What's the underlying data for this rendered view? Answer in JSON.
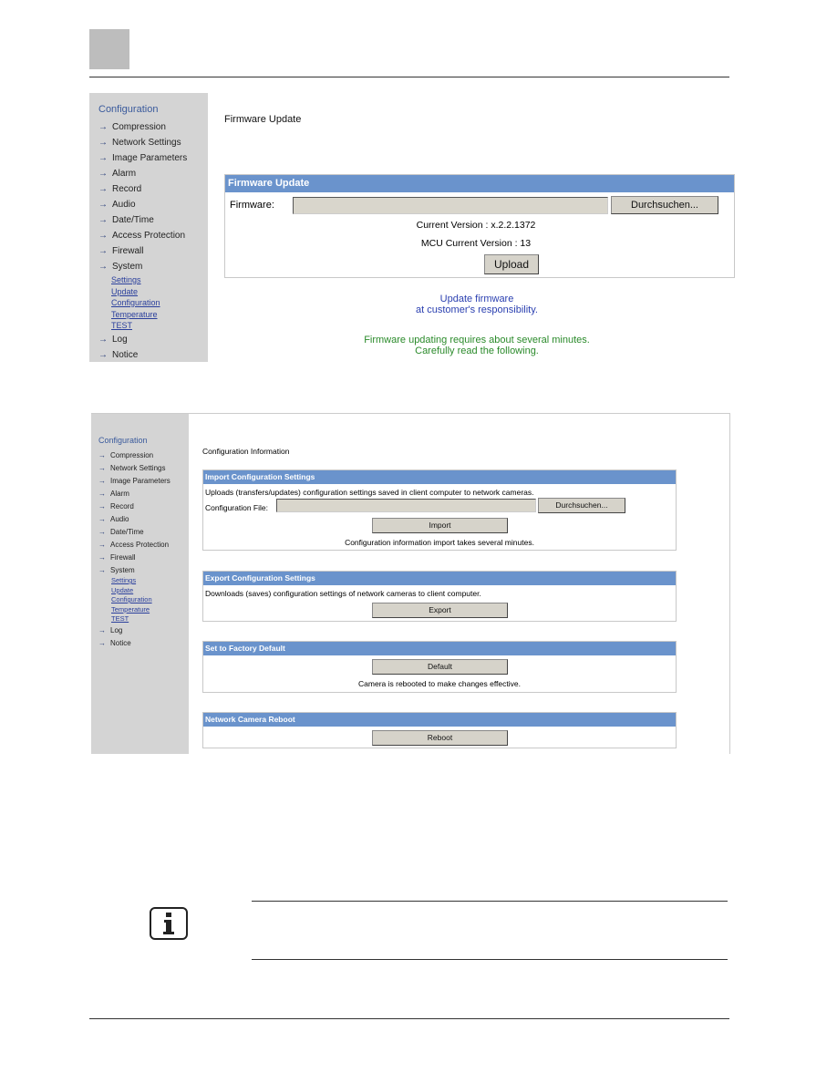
{
  "sidebar": {
    "title": "Configuration",
    "items": [
      "Compression",
      "Network Settings",
      "Image Parameters",
      "Alarm",
      "Record",
      "Audio",
      "Date/Time",
      "Access Protection",
      "Firewall",
      "System"
    ],
    "sub_items": [
      "Settings",
      "Update",
      "Configuration",
      "Temperature",
      "TEST"
    ],
    "tail_items": [
      "Log",
      "Notice"
    ]
  },
  "firmware": {
    "page_title": "Firmware Update",
    "panel_title": "Firmware Update",
    "field_label": "Firmware:",
    "browse_label": "Durchsuchen...",
    "current_version": "Current Version : x.2.2.1372",
    "mcu_version": "MCU Current Version : 13",
    "upload_label": "Upload",
    "warning_line1": "Update firmware",
    "warning_line2": "at customer's responsibility.",
    "note_line1": "Firmware updating requires about several minutes.",
    "note_line2": "Carefully read the following."
  },
  "config": {
    "page_title": "Configuration Information",
    "import": {
      "title": "Import Configuration Settings",
      "description": "Uploads (transfers/updates) configuration settings saved in client computer to network cameras.",
      "field_label": "Configuration File:",
      "browse_label": "Durchsuchen...",
      "button": "Import",
      "note": "Configuration information import takes several minutes."
    },
    "export": {
      "title": "Export Configuration Settings",
      "description": "Downloads (saves) configuration settings of network cameras to client computer.",
      "button": "Export"
    },
    "factory": {
      "title": "Set to Factory Default",
      "button": "Default",
      "note": "Camera is rebooted to make changes effective."
    },
    "reboot": {
      "title": "Network Camera Reboot",
      "button": "Reboot"
    }
  },
  "icons": {
    "info": "info-icon"
  },
  "colors": {
    "panel_header": "#6a93cc",
    "warning_blue": "#2a3fb0",
    "note_green": "#2a8a2a",
    "sidebar_bg": "#d4d4d4"
  }
}
